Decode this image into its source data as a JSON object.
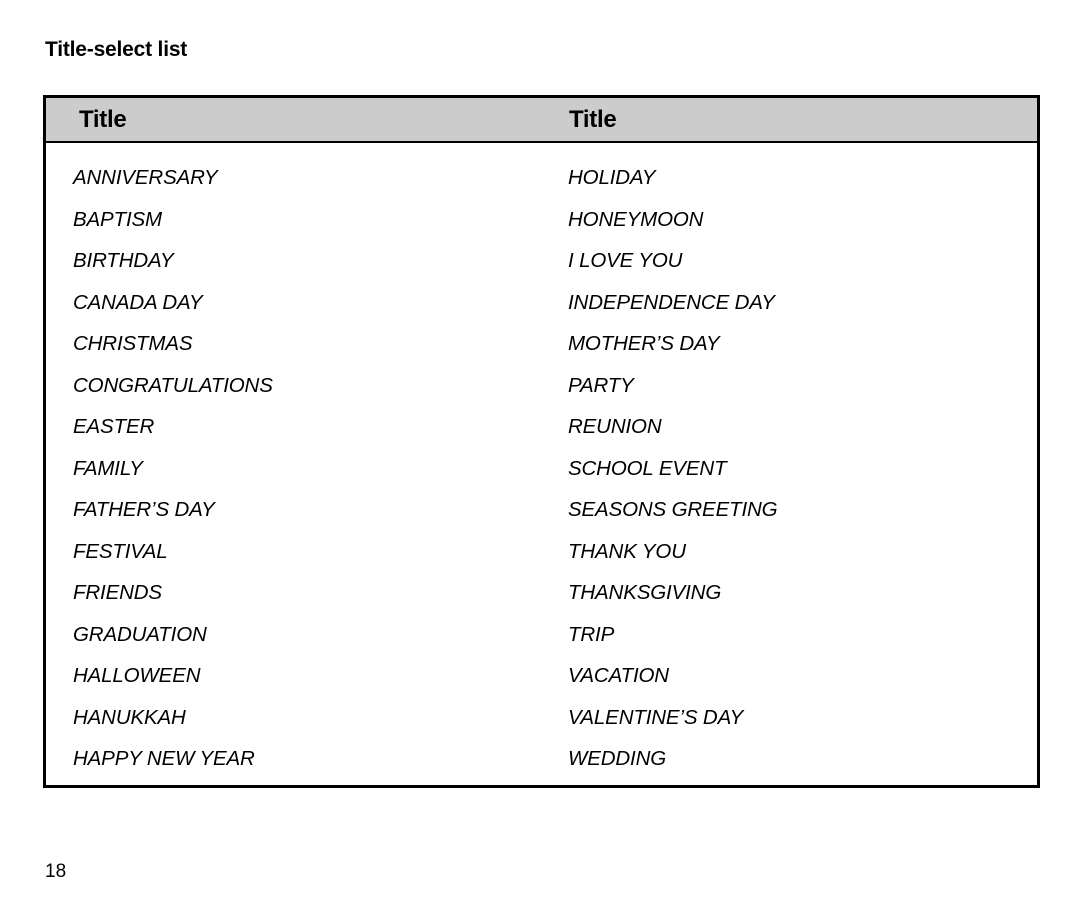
{
  "page": {
    "heading": "Title-select list",
    "page_number": "18",
    "colors": {
      "header_background": "#cccccc",
      "border": "#000000",
      "text": "#000000",
      "page_background": "#ffffff"
    }
  },
  "table": {
    "headers": [
      "Title",
      "Title"
    ],
    "columns": [
      {
        "header": "Title",
        "items": [
          "ANNIVERSARY",
          "BAPTISM",
          "BIRTHDAY",
          "CANADA DAY",
          "CHRISTMAS",
          "CONGRATULATIONS",
          "EASTER",
          "FAMILY",
          "FATHER’S DAY",
          "FESTIVAL",
          "FRIENDS",
          "GRADUATION",
          "HALLOWEEN",
          "HANUKKAH",
          "HAPPY NEW YEAR"
        ]
      },
      {
        "header": "Title",
        "items": [
          "HOLIDAY",
          "HONEYMOON",
          "I LOVE YOU",
          "INDEPENDENCE DAY",
          "MOTHER’S DAY",
          "PARTY",
          "REUNION",
          "SCHOOL EVENT",
          "SEASONS GREETING",
          "THANK YOU",
          "THANKSGIVING",
          "TRIP",
          "VACATION",
          "VALENTINE’S DAY",
          "WEDDING"
        ]
      }
    ]
  }
}
